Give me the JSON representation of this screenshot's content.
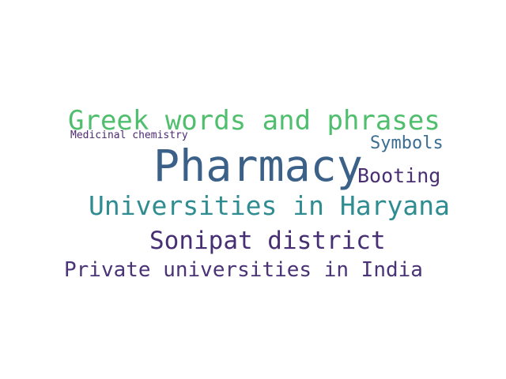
{
  "words": {
    "greek_words_and_phrases": {
      "text": "Greek words and phrases",
      "color": "#4fbe6d"
    },
    "medicinal_chemistry": {
      "text": "Medicinal chemistry",
      "color": "#4d2a72"
    },
    "symbols": {
      "text": "Symbols",
      "color": "#3a6d92"
    },
    "pharmacy": {
      "text": "Pharmacy",
      "color": "#3b6188"
    },
    "booting": {
      "text": "Booting",
      "color": "#4a2f73"
    },
    "universities_in_haryana": {
      "text": "Universities in Haryana",
      "color": "#2f8d91"
    },
    "sonipat_district": {
      "text": "Sonipat district",
      "color": "#472f73"
    },
    "private_universities_in_india": {
      "text": "Private universities in India",
      "color": "#4a3377"
    }
  }
}
